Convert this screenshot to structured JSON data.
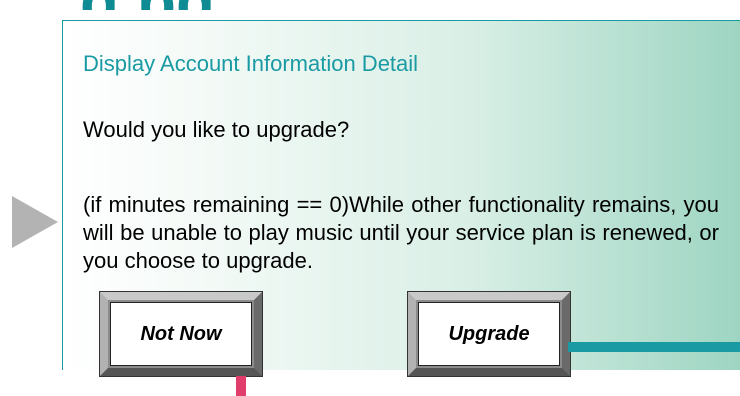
{
  "header": {
    "title_fragment": "g  pg"
  },
  "screen": {
    "title": "Display  Account Information  Detail",
    "question": "Would you like  to upgrade?",
    "body": "(if  minutes remaining  == 0)While  other functionality remains,  you will  be unable to play music until your service plan is renewed, or you choose to upgrade."
  },
  "buttons": {
    "not_now": "Not Now",
    "upgrade": "Upgrade"
  },
  "colors": {
    "accent": "#1a9aa3",
    "connector_pink": "#e03c6c",
    "arrow_gray": "#b3b3b3"
  },
  "icons": {
    "flow_arrow": "right-triangle-arrow"
  }
}
